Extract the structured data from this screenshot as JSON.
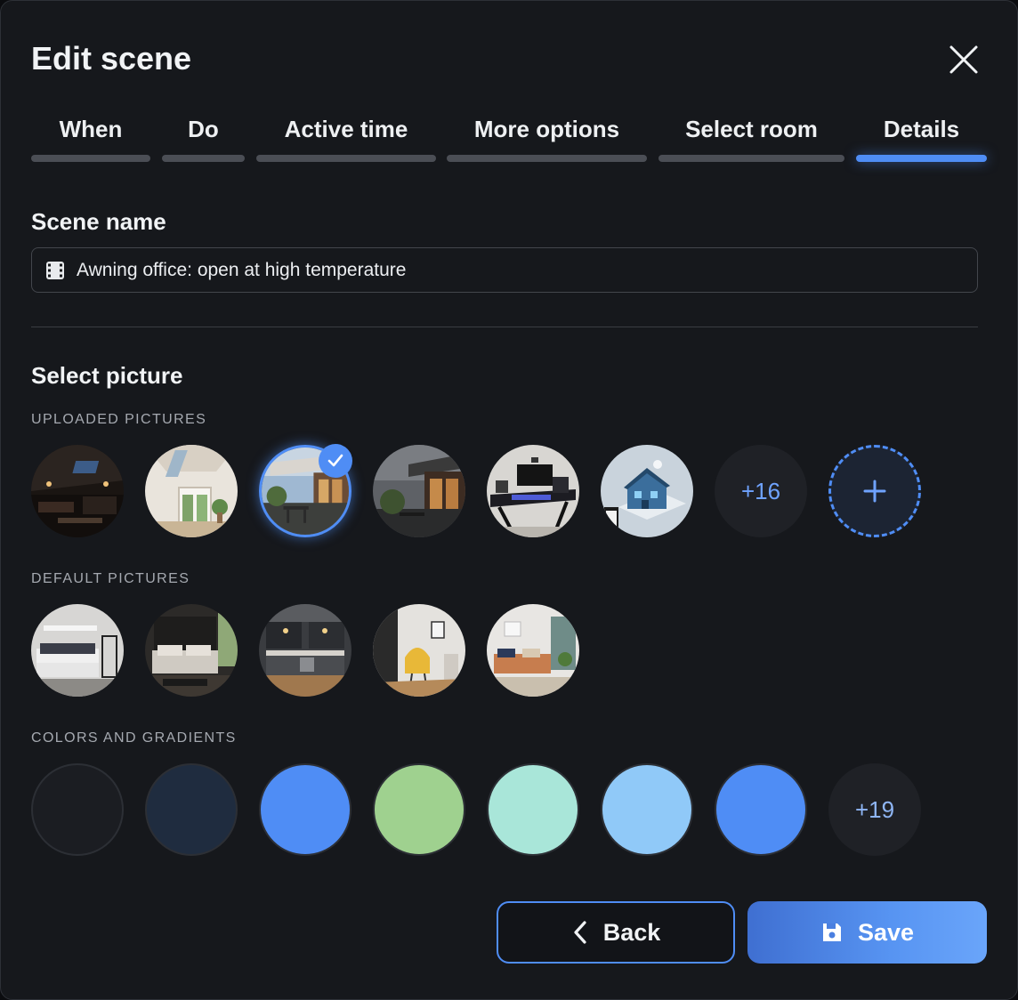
{
  "dialog": {
    "title": "Edit scene"
  },
  "tabs": [
    {
      "label": "When"
    },
    {
      "label": "Do"
    },
    {
      "label": "Active time"
    },
    {
      "label": "More options"
    },
    {
      "label": "Select room"
    },
    {
      "label": "Details"
    }
  ],
  "active_tab": "Details",
  "scene_name": {
    "label": "Scene name",
    "value": "Awning office: open at high temperature",
    "icon": "film-icon"
  },
  "select_picture": {
    "title": "Select picture",
    "uploaded": {
      "label": "UPLOADED PICTURES",
      "items": [
        "dark-living-room",
        "bright-hallway",
        "awning-terrace",
        "terrace-evening",
        "gaming-desk",
        "smart-house-model"
      ],
      "selected_index": 2,
      "more": "+16",
      "add_icon": "plus-icon"
    },
    "default": {
      "label": "DEFAULT PICTURES",
      "items": [
        "white-bedroom",
        "dark-bedroom",
        "kitchen",
        "reading-corner",
        "living-room"
      ]
    },
    "colors": {
      "label": "COLORS AND GRADIENTS",
      "swatches": [
        "#1b1d22",
        "#1f2c3f",
        "#4f8df5",
        "#9fd18f",
        "#a9e6d9",
        "#90c9f8",
        "#4f8df5"
      ],
      "more": "+19"
    }
  },
  "buttons": {
    "back": "Back",
    "save": "Save"
  },
  "colors": {
    "accent": "#4f8df5",
    "background": "#16181c"
  }
}
